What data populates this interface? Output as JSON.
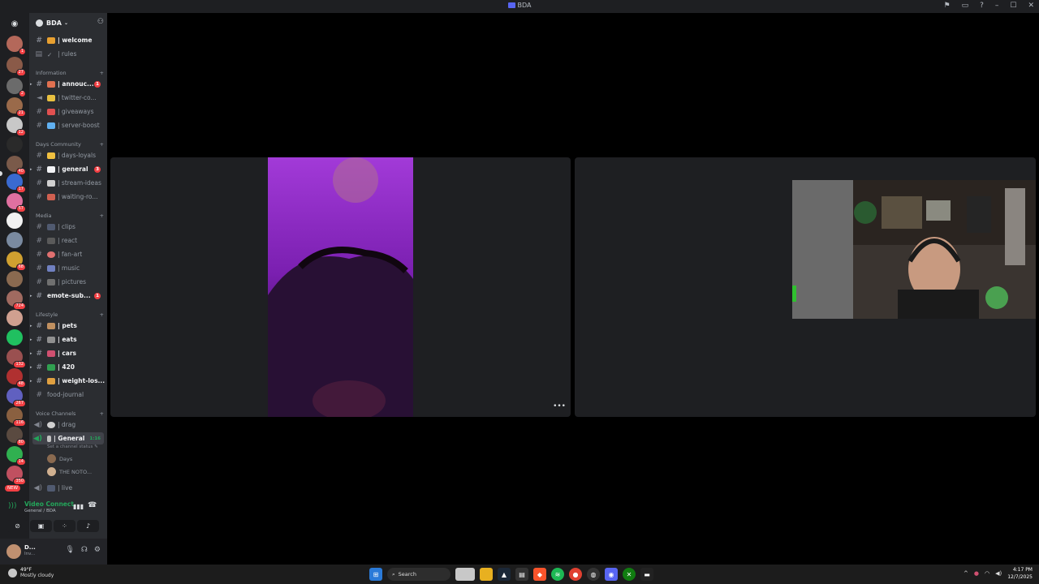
{
  "window": {
    "title": "BDA"
  },
  "guild": {
    "name": "BDA"
  },
  "server_badges": [
    "1",
    "27",
    "2",
    "21",
    "12",
    "40",
    "17",
    "57",
    "68",
    "724",
    "132",
    "48",
    "267",
    "116",
    "80",
    "14",
    "350",
    "NEW"
  ],
  "channels_top": [
    {
      "label": "| welcome",
      "unread": true
    },
    {
      "label": "| rules",
      "unread": false
    }
  ],
  "categories": {
    "information": "Information",
    "days_community": "Days Community",
    "media": "Media",
    "lifestyle": "Lifestyle",
    "voice": "Voice Channels"
  },
  "channels_information": [
    {
      "label": "| annouc...",
      "unread": true,
      "count": "1"
    },
    {
      "label": "| twitter-co...",
      "unread": false
    },
    {
      "label": "| giveaways",
      "unread": false
    },
    {
      "label": "| server-boost",
      "unread": false
    }
  ],
  "channels_days": [
    {
      "label": "| days-loyals",
      "unread": false
    },
    {
      "label": "| general",
      "unread": true,
      "count": "3"
    },
    {
      "label": "| stream-ideas",
      "unread": false
    },
    {
      "label": "| waiting-ro...",
      "unread": false
    }
  ],
  "channels_media": [
    {
      "label": "| clips",
      "unread": false
    },
    {
      "label": "| react",
      "unread": false
    },
    {
      "label": "| fan-art",
      "unread": false
    },
    {
      "label": "| music",
      "unread": false
    },
    {
      "label": "| pictures",
      "unread": false
    },
    {
      "label": "emote-sub...",
      "unread": true,
      "count": "1"
    }
  ],
  "channels_lifestyle": [
    {
      "label": "| pets",
      "unread": true
    },
    {
      "label": "| eats",
      "unread": true
    },
    {
      "label": "| cars",
      "unread": true
    },
    {
      "label": "| 420",
      "unread": true
    },
    {
      "label": "| weight-los...",
      "unread": true
    },
    {
      "label": "food-journal",
      "unread": false
    }
  ],
  "voice_channels": {
    "drag": "| drag",
    "general": "| General",
    "general_time": "1:16",
    "general_status": "Set a channel status",
    "users": [
      "Days",
      "THE NOTO..."
    ],
    "live": "| live"
  },
  "voice_panel": {
    "title": "Video Connect",
    "subtitle": "General / BDA"
  },
  "user": {
    "name": "D...",
    "status": "Inv..."
  },
  "taskbar": {
    "weather_temp": "49°F",
    "weather_desc": "Mostly cloudy",
    "search": "Search",
    "time": "4:17 PM",
    "date": "12/7/2025"
  },
  "colors": {
    "accent": "#5865f2",
    "voice_green": "#23a55a",
    "unread_red": "#f23f43"
  }
}
